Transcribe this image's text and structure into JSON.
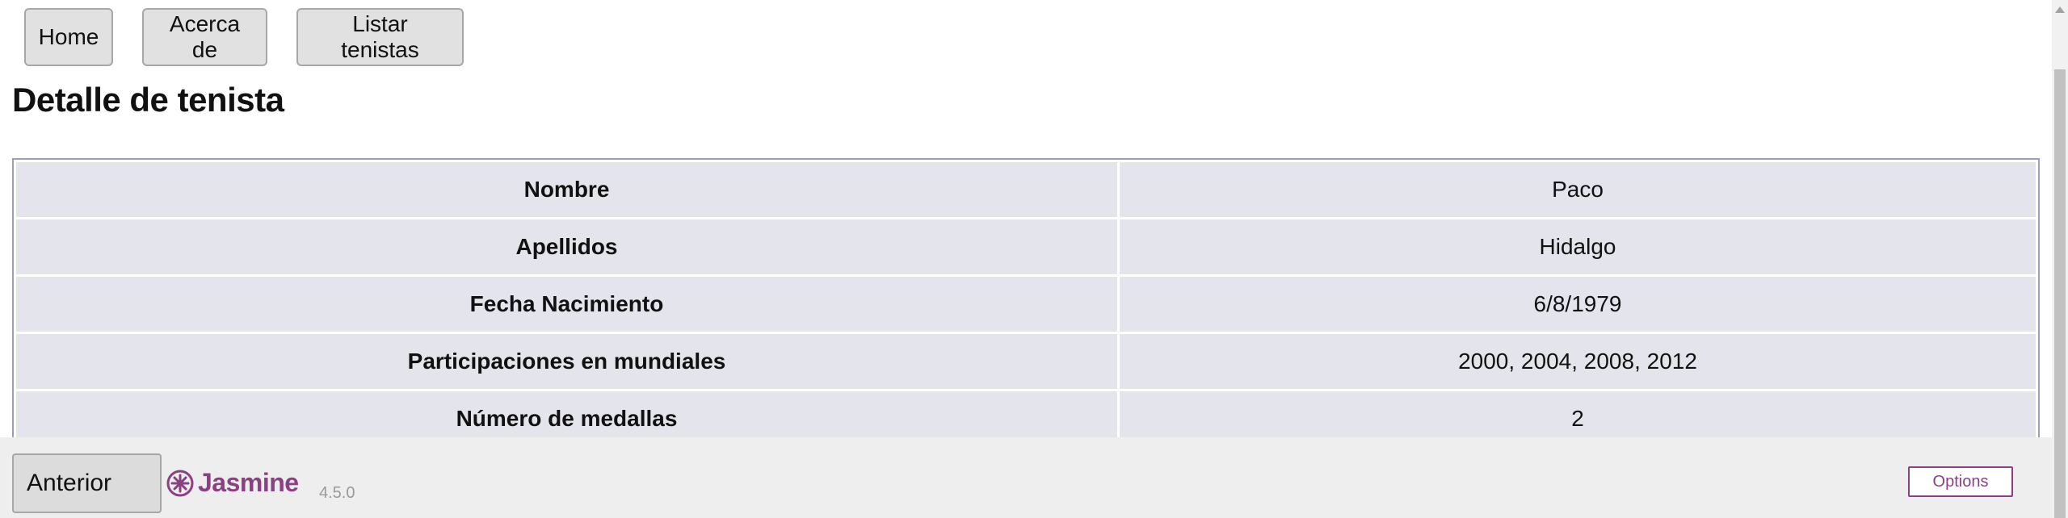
{
  "nav": {
    "home_label": "Home",
    "about_label": "Acerca de",
    "list_label": "Listar tenistas"
  },
  "page": {
    "title": "Detalle de tenista"
  },
  "detail": {
    "rows": [
      {
        "label": "Nombre",
        "value": "Paco"
      },
      {
        "label": "Apellidos",
        "value": "Hidalgo"
      },
      {
        "label": "Fecha Nacimiento",
        "value": "6/8/1979"
      },
      {
        "label": "Participaciones en mundiales",
        "value": "2000, 2004, 2008, 2012"
      },
      {
        "label": "Número de medallas",
        "value": "2"
      }
    ]
  },
  "jasmine": {
    "prev_label": "Anterior",
    "brand": "Jasmine",
    "version": "4.5.0",
    "options_label": "Options"
  },
  "colors": {
    "jasmine_purple": "#8a4182",
    "table_cell_bg": "#e4e4ed",
    "button_bg": "#e1e1e1"
  }
}
